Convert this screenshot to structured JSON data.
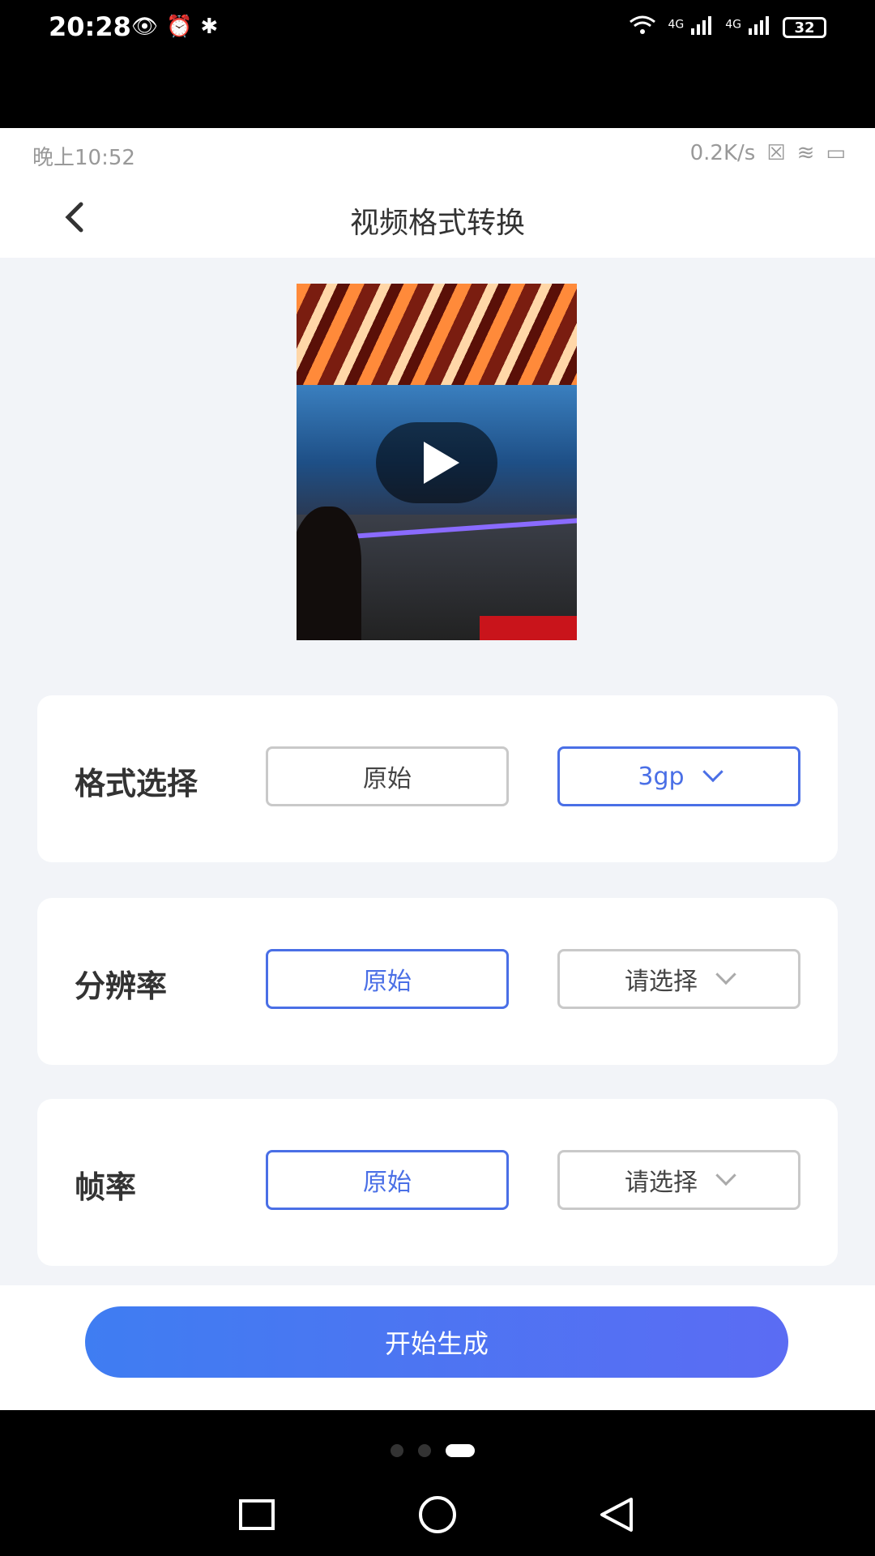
{
  "outer_status": {
    "time": "20:28",
    "left_icons": [
      "eye-icon",
      "alarm-icon",
      "bluetooth-icon"
    ],
    "net1": "4G",
    "net2": "4G",
    "battery": "32"
  },
  "inner_status": {
    "time": "晚上10:52",
    "speed": "0.2K/s"
  },
  "header": {
    "title": "视频格式转换",
    "back_icon": "chevron-left-icon"
  },
  "video": {
    "play_icon": "play-icon"
  },
  "settings": [
    {
      "label": "格式选择",
      "option1": "原始",
      "option2": "3gp",
      "selected": "option2"
    },
    {
      "label": "分辨率",
      "option1": "原始",
      "option2": "请选择",
      "selected": "option1"
    },
    {
      "label": "帧率",
      "option1": "原始",
      "option2": "请选择",
      "selected": "option1"
    }
  ],
  "action": {
    "start_label": "开始生成"
  },
  "colors": {
    "accent": "#4a6fe6",
    "button_gradient_start": "#3f7df2",
    "button_gradient_end": "#5b6cf3",
    "background": "#f2f4f8"
  }
}
